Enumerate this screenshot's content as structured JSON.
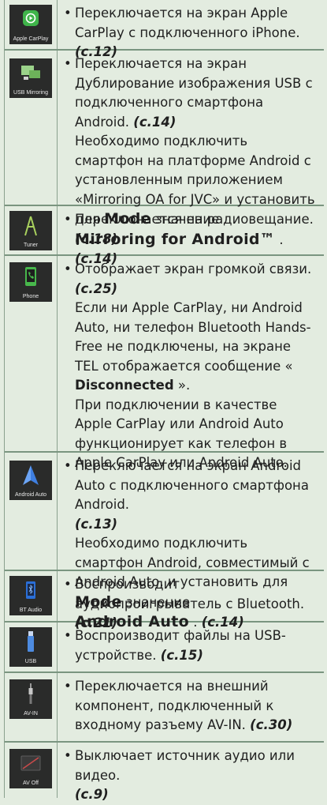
{
  "rows": [
    {
      "icon": {
        "label": "Apple CarPlay",
        "name": "carplay-icon"
      },
      "text": "Переключается на экран Apple CarPlay с подключенного iPhone.",
      "ref": "(c.12)"
    },
    {
      "icon": {
        "label": "USB Mirroring",
        "name": "usb-mirroring-icon"
      },
      "text": "Переключается на экран Дублирование изображения USB с подключенного смартфона Android.",
      "ref": "(c.14)",
      "extra_text": "Необходимо подключить смартфон на платформе Android с установленным приложением «Mirroring OA for JVC» и установить для",
      "mode_word": "Mode",
      "mode_suffix": "значение",
      "mode_value": "Mirroring for Android™",
      "extra_ref": "(c.14)"
    },
    {
      "icon": {
        "label": "Tuner",
        "name": "tuner-icon"
      },
      "text": "Переключается на радиовещание.",
      "ref": "(c.18)"
    },
    {
      "icon": {
        "label": "Phone",
        "name": "phone-icon"
      },
      "text": "Отображает экран громкой связи.",
      "ref": "(c.25)",
      "extra_text": "Если ни Apple CarPlay, ни Android Auto, ни телефон Bluetooth Hands-Free не подключены, на экране TEL отображается сообщение «",
      "extra_strong": "Disconnected",
      "extra_text_end": "».",
      "extra_text2": "При подключении в качестве Apple CarPlay или Android Auto функционирует как телефон в Apple CarPlay или Android Auto."
    },
    {
      "icon": {
        "label": "Android Auto",
        "name": "android-auto-icon"
      },
      "text": "Переключается на экран Android Auto с подключенного смартфона Android.",
      "ref": "(c.13)",
      "extra_text": "Необходимо подключить смартфон Android, совместимый с Android Auto, и установить для",
      "mode_word": "Mode",
      "mode_suffix": "значение",
      "mode_value": "Android Auto",
      "extra_ref": "(c.14)"
    },
    {
      "icon": {
        "label": "BT Audio",
        "name": "bt-audio-icon"
      },
      "text": "Воспроизводит аудиопроигрыватель с Bluetooth.",
      "ref": "(c.21)"
    },
    {
      "icon": {
        "label": "USB",
        "name": "usb-icon"
      },
      "text": "Воспроизводит файлы на USB-устройстве.",
      "ref": "(c.15)"
    },
    {
      "icon": {
        "label": "AV-IN",
        "name": "av-in-icon"
      },
      "text": "Переключается на внешний компонент, подключенный к входному разъему AV-IN.",
      "ref": "(c.30)"
    },
    {
      "icon": {
        "label": "AV Off",
        "name": "av-off-icon"
      },
      "text": "Выключает источник аудио или видео.",
      "ref": "(c.9)"
    }
  ]
}
